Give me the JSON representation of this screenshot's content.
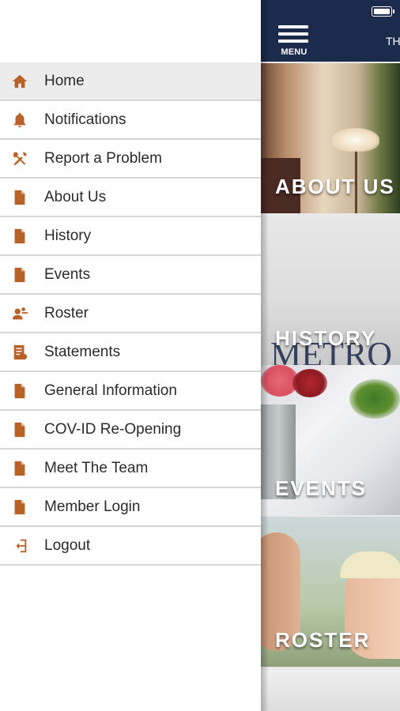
{
  "app_bar": {
    "menu_label": "MENU",
    "title_fragment": "TH",
    "background_color": "#1c2a4c"
  },
  "drawer": {
    "accent_color": "#b8622a",
    "items": [
      {
        "label": "Home",
        "icon": "home-icon",
        "active": true
      },
      {
        "label": "Notifications",
        "icon": "bell-icon"
      },
      {
        "label": "Report a Problem",
        "icon": "tools-icon"
      },
      {
        "label": "About Us",
        "icon": "document-icon"
      },
      {
        "label": "History",
        "icon": "document-icon"
      },
      {
        "label": "Events",
        "icon": "document-icon"
      },
      {
        "label": "Roster",
        "icon": "people-icon"
      },
      {
        "label": "Statements",
        "icon": "statement-icon"
      },
      {
        "label": "General Information",
        "icon": "document-icon"
      },
      {
        "label": "COV-ID Re-Opening",
        "icon": "document-icon"
      },
      {
        "label": "Meet The Team",
        "icon": "document-icon"
      },
      {
        "label": "Member Login",
        "icon": "document-icon"
      },
      {
        "label": "Logout",
        "icon": "logout-icon"
      }
    ]
  },
  "tiles": [
    {
      "caption": "ABOUT US"
    },
    {
      "caption": "HISTORY",
      "watermark": "METRO"
    },
    {
      "caption": "EVENTS"
    },
    {
      "caption": "ROSTER"
    }
  ]
}
